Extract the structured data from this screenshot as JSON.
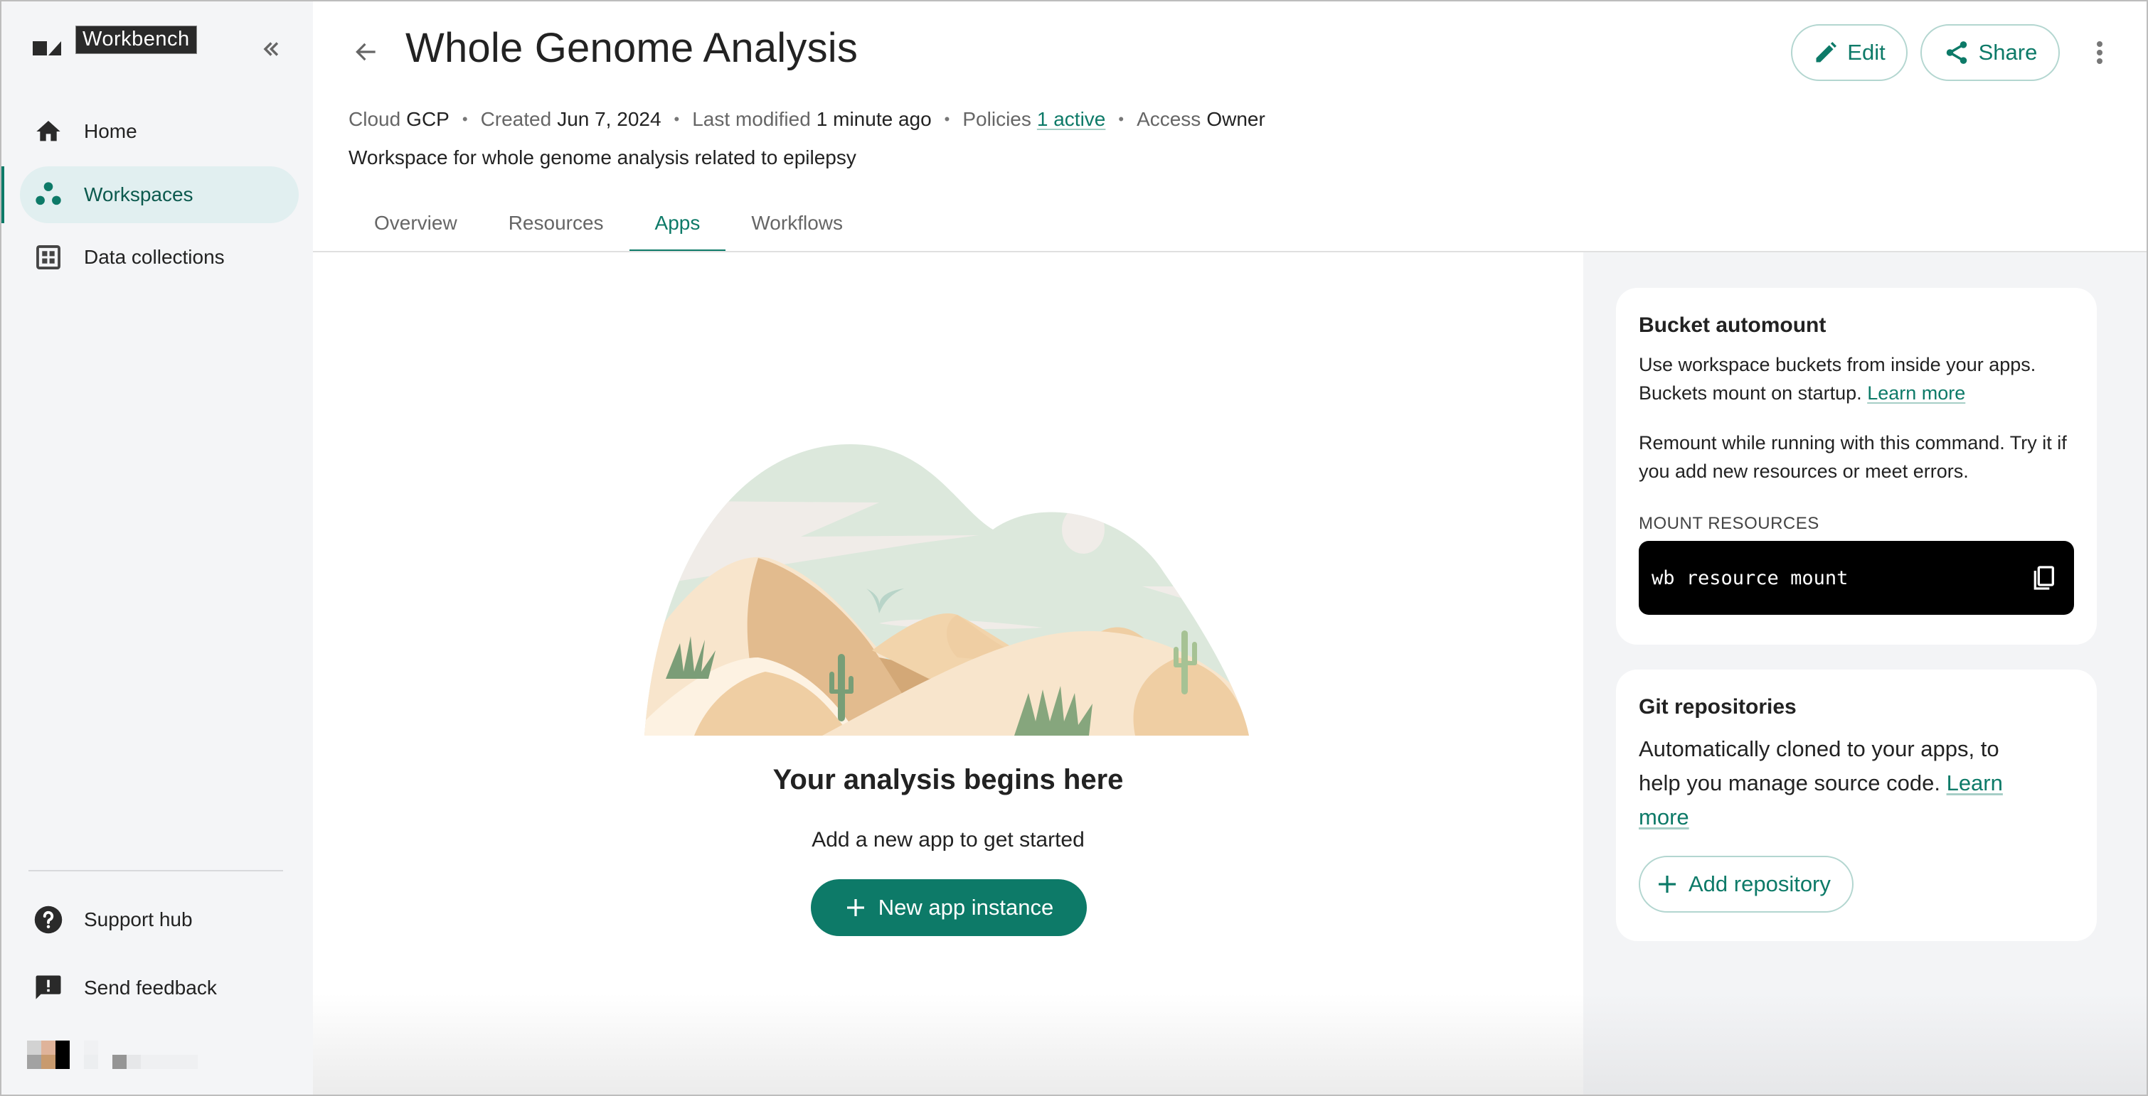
{
  "app": {
    "name": "Workbench"
  },
  "sidebar": {
    "collapse_label": "«",
    "items": [
      {
        "label": "Home",
        "icon": "home-icon",
        "active": false
      },
      {
        "label": "Workspaces",
        "icon": "workspaces-icon",
        "active": true
      },
      {
        "label": "Data collections",
        "icon": "data-collections-icon",
        "active": false
      }
    ],
    "footer_items": [
      {
        "label": "Support hub",
        "icon": "help-circle-icon"
      },
      {
        "label": "Send feedback",
        "icon": "feedback-icon"
      }
    ]
  },
  "header": {
    "title": "Whole Genome Analysis",
    "meta": {
      "cloud_key": "Cloud",
      "cloud_value": "GCP",
      "created_key": "Created",
      "created_value": "Jun 7, 2024",
      "modified_key": "Last modified",
      "modified_value": "1 minute ago",
      "policies_key": "Policies",
      "policies_value": "1 active",
      "access_key": "Access",
      "access_value": "Owner",
      "separator": "•"
    },
    "description": "Workspace for whole genome analysis related to epilepsy",
    "edit_label": "Edit",
    "share_label": "Share"
  },
  "tabs": [
    {
      "label": "Overview",
      "active": false
    },
    {
      "label": "Resources",
      "active": false
    },
    {
      "label": "Apps",
      "active": true
    },
    {
      "label": "Workflows",
      "active": false
    }
  ],
  "empty_state": {
    "title": "Your analysis begins here",
    "subtitle": "Add a new app to get started",
    "button_label": "New app instance"
  },
  "bucket_automount": {
    "title": "Bucket automount",
    "text1": "Use workspace buckets from inside your apps. Buckets mount on startup.",
    "learn_more": "Learn more",
    "text2": "Remount while running with this command. Try it if you add new resources or meet errors.",
    "section_label": "MOUNT RESOURCES",
    "command": "wb resource mount"
  },
  "git_repositories": {
    "title": "Git repositories",
    "text": "Automatically cloned to your apps, to help you manage source code.",
    "learn_more": "Learn more",
    "add_label": "Add repository"
  },
  "colors": {
    "accent": "#0d7a68",
    "accent_light": "#e1eff0",
    "sidebar_bg": "#f4f5f7",
    "panel_bg": "#f3f4f6"
  }
}
